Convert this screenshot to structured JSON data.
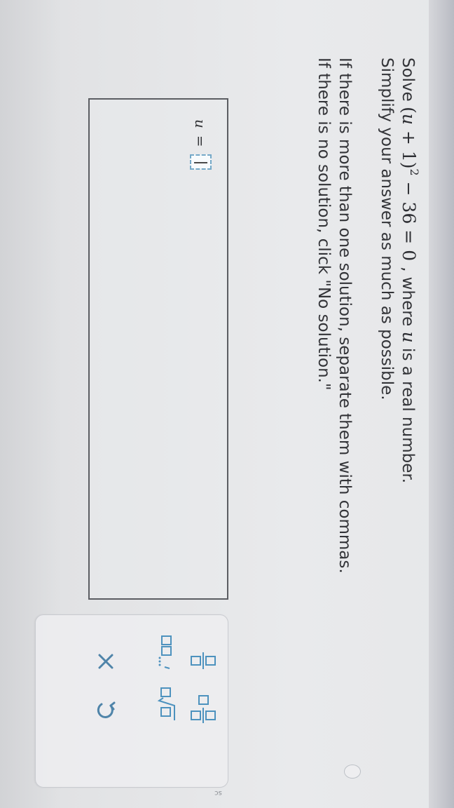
{
  "problem": {
    "solve_label": "Solve",
    "equation": {
      "open_paren": "(",
      "variable": "u",
      "plus_one": " + 1)",
      "exponent": "2",
      "rest": " − 36 = 0"
    },
    "where_text": ", where ",
    "variable_inline": "u",
    "real_number_text": " is a real number.",
    "instruction_simplify": "Simplify your answer as much as possible.",
    "instruction_multiple": "If there is more than one solution, separate them with commas.",
    "instruction_no_solution": "If there is no solution, click \"No solution.\""
  },
  "answer": {
    "variable": "u",
    "equals": "=",
    "value": ""
  },
  "keypad": {
    "icons": {
      "fraction": "fraction-icon",
      "mixed_number": "mixed-number-icon",
      "list": "list-icon",
      "radical": "radical-icon",
      "clear": "close-icon",
      "undo": "undo-icon"
    }
  },
  "edge_fragment": "sc",
  "colors": {
    "accent": "#4d92be",
    "text": "#333438",
    "border": "#5b5d62",
    "panel": "#eeeff1"
  }
}
